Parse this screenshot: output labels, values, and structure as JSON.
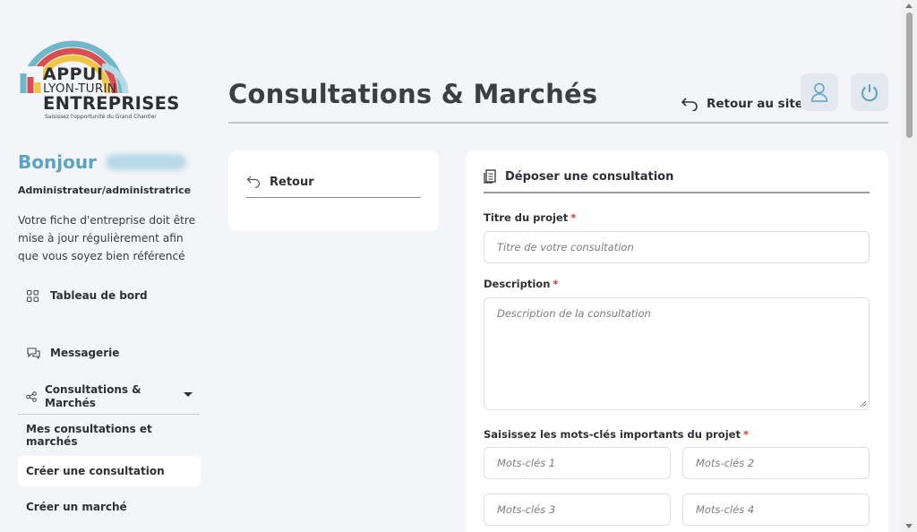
{
  "brand": {
    "line1": "APPUI",
    "line2": "LYON-TURIN",
    "line3": "ENTREPRISES",
    "tagline": "Saisissez l'opportunité du Grand Chantier",
    "colors": [
      "#6fb8cc",
      "#d94f4f",
      "#f0c542",
      "#b7dbe6"
    ]
  },
  "sidebar": {
    "greeting": "Bonjour",
    "role": "Administrateur/administratrice",
    "notice": "Votre fiche d'entreprise doit être mise à jour régulièrement afin que vous soyez bien référencé",
    "nav": {
      "dashboard": "Tableau de bord",
      "messages": "Messagerie",
      "consultations": "Consultations & Marchés"
    },
    "submenu": {
      "mine": "Mes consultations et marchés",
      "create_consultation": "Créer une consultation",
      "create_market": "Créer un marché"
    }
  },
  "header": {
    "title": "Consultations & Marchés",
    "back_to_site": "Retour au site"
  },
  "back_card": {
    "label": "Retour"
  },
  "form": {
    "heading": "Déposer une consultation",
    "title_label": "Titre du projet",
    "title_placeholder": "Titre de votre consultation",
    "description_label": "Description",
    "description_placeholder": "Description de la consultation",
    "keywords_label": "Saisissez les mots-clés importants du projet",
    "required_mark": "*",
    "keyword_placeholders": [
      "Mots-clés 1",
      "Mots-clés 2",
      "Mots-clés 3",
      "Mots-clés 4"
    ]
  },
  "colors": {
    "accent": "#5aa3c2",
    "required": "#d23c3c",
    "background": "#f3f5f8"
  }
}
